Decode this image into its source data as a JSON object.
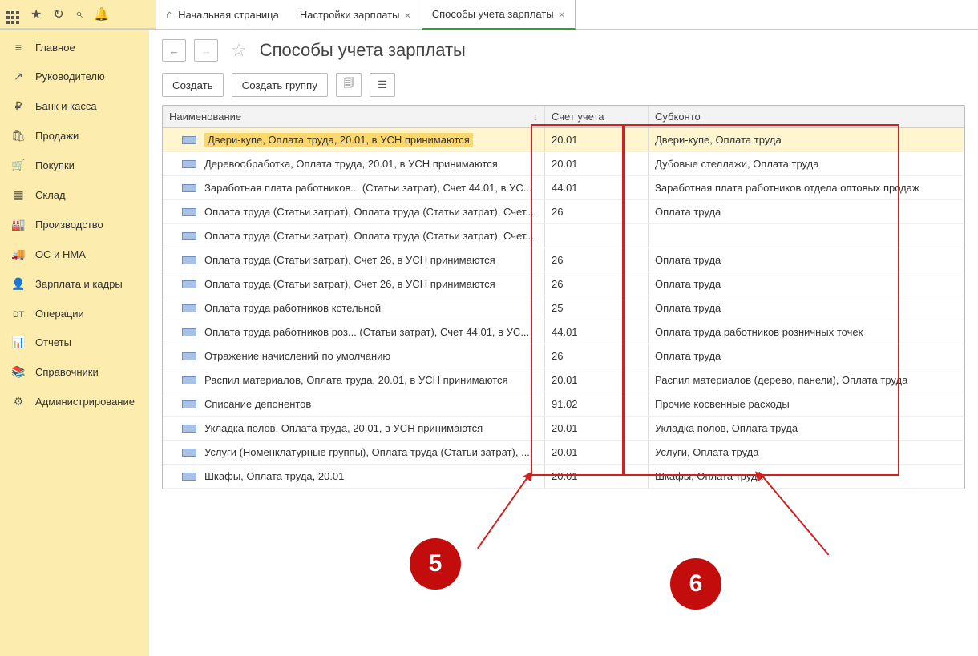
{
  "tabs": {
    "home": "Начальная страница",
    "settings": "Настройки зарплаты",
    "active": "Способы учета зарплаты"
  },
  "sidebar": {
    "items": [
      {
        "icon": "≡",
        "label": "Главное"
      },
      {
        "icon": "↗",
        "label": "Руководителю"
      },
      {
        "icon": "₽",
        "label": "Банк и касса"
      },
      {
        "icon": "🛍",
        "label": "Продажи"
      },
      {
        "icon": "🛒",
        "label": "Покупки"
      },
      {
        "icon": "▦",
        "label": "Склад"
      },
      {
        "icon": "🏭",
        "label": "Производство"
      },
      {
        "icon": "🚚",
        "label": "ОС и НМА"
      },
      {
        "icon": "👤",
        "label": "Зарплата и кадры"
      },
      {
        "icon": "ᴅᴛ",
        "label": "Операции"
      },
      {
        "icon": "📊",
        "label": "Отчеты"
      },
      {
        "icon": "📚",
        "label": "Справочники"
      },
      {
        "icon": "⚙",
        "label": "Администрирование"
      }
    ]
  },
  "page": {
    "title": "Способы учета зарплаты"
  },
  "toolbar": {
    "create": "Создать",
    "create_group": "Создать группу"
  },
  "grid": {
    "headers": {
      "name": "Наименование",
      "account": "Счет учета",
      "sub": "Субконто"
    },
    "rows": [
      {
        "name": "Двери-купе, Оплата труда, 20.01, в УСН принимаются",
        "acct": "20.01",
        "sub": "Двери-купе, Оплата труда",
        "selected": true
      },
      {
        "name": "Деревообработка, Оплата труда, 20.01, в УСН принимаются",
        "acct": "20.01",
        "sub": "Дубовые стеллажи, Оплата труда"
      },
      {
        "name": "Заработная плата работников... (Статьи затрат), Счет 44.01, в УС...",
        "acct": "44.01",
        "sub": "Заработная плата работников отдела оптовых продаж"
      },
      {
        "name": "Оплата труда (Статьи затрат), Оплата труда (Статьи затрат), Счет...",
        "acct": "26",
        "sub": "Оплата труда"
      },
      {
        "name": "Оплата труда (Статьи затрат), Оплата труда (Статьи затрат), Счет...",
        "acct": "",
        "sub": ""
      },
      {
        "name": "Оплата труда (Статьи затрат), Счет 26, в УСН принимаются",
        "acct": "26",
        "sub": "Оплата труда"
      },
      {
        "name": "Оплата труда (Статьи затрат), Счет 26, в УСН принимаются",
        "acct": "26",
        "sub": "Оплата труда"
      },
      {
        "name": "Оплата труда работников котельной",
        "acct": "25",
        "sub": "Оплата труда"
      },
      {
        "name": "Оплата труда работников роз... (Статьи затрат), Счет 44.01, в УС...",
        "acct": "44.01",
        "sub": "Оплата труда работников розничных точек"
      },
      {
        "name": "Отражение начислений по умолчанию",
        "acct": "26",
        "sub": "Оплата труда"
      },
      {
        "name": "Распил материалов, Оплата труда, 20.01, в УСН принимаются",
        "acct": "20.01",
        "sub": "Распил материалов (дерево, панели), Оплата труда"
      },
      {
        "name": "Списание депонентов",
        "acct": "91.02",
        "sub": "Прочие косвенные расходы"
      },
      {
        "name": "Укладка полов, Оплата труда, 20.01, в УСН принимаются",
        "acct": "20.01",
        "sub": "Укладка полов, Оплата труда"
      },
      {
        "name": "Услуги (Номенклатурные группы), Оплата труда (Статьи затрат), ...",
        "acct": "20.01",
        "sub": "Услуги, Оплата труда"
      },
      {
        "name": "Шкафы, Оплата труда, 20.01",
        "acct": "20.01",
        "sub": "Шкафы, Оплата труда"
      }
    ]
  },
  "annotations": {
    "marker5": "5",
    "marker6": "6"
  }
}
